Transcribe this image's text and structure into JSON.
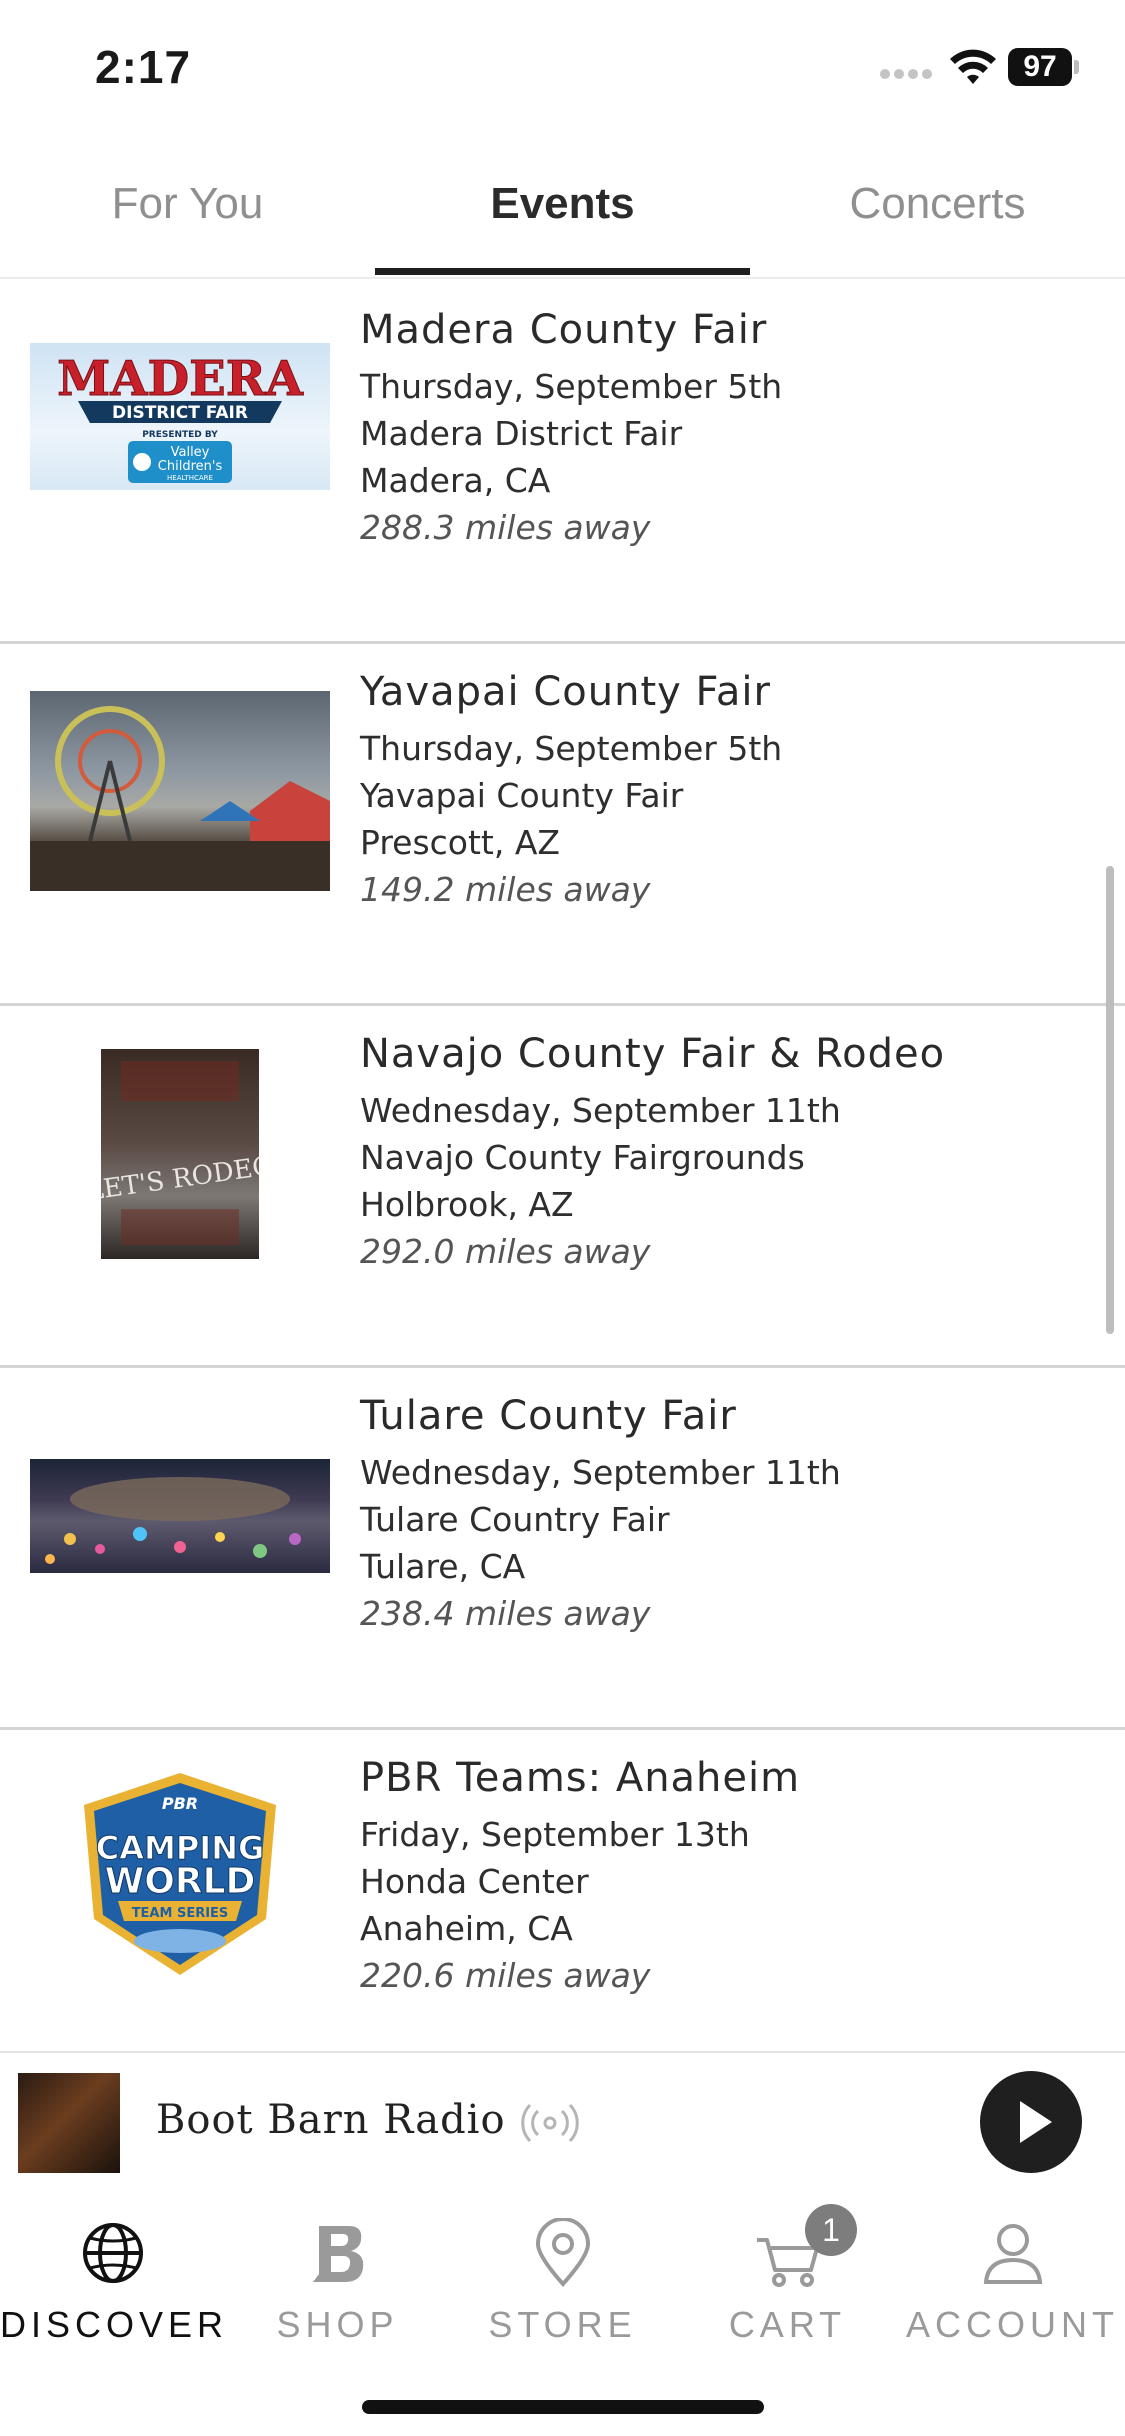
{
  "status": {
    "time": "2:17",
    "battery": "97"
  },
  "tabs": [
    {
      "label": "For You"
    },
    {
      "label": "Events"
    },
    {
      "label": "Concerts"
    }
  ],
  "events": [
    {
      "title": "Madera County Fair",
      "date": "Thursday, September 5th",
      "venue": "Madera District Fair",
      "city": "Madera, CA",
      "distance": "288.3 miles away",
      "logo": {
        "line1": "MADERA",
        "line2": "DISTRICT FAIR",
        "line3": "PRESENTED BY",
        "line4": "Valley",
        "line5": "Children's",
        "line6": "HEALTHCARE"
      }
    },
    {
      "title": "Yavapai County Fair",
      "date": "Thursday, September 5th",
      "venue": "Yavapai County Fair",
      "city": "Prescott, AZ",
      "distance": "149.2 miles away"
    },
    {
      "title": "Navajo County Fair & Rodeo",
      "date": "Wednesday, September 11th",
      "venue": "Navajo County Fairgrounds",
      "city": "Holbrook, AZ",
      "distance": "292.0 miles away",
      "poster_text": "LET'S RODEO"
    },
    {
      "title": "Tulare County Fair",
      "date": "Wednesday, September 11th",
      "venue": "Tulare Country Fair",
      "city": "Tulare, CA",
      "distance": "238.4 miles away"
    },
    {
      "title": "PBR Teams: Anaheim",
      "date": "Friday, September 13th",
      "venue": "Honda Center",
      "city": "Anaheim, CA",
      "distance": "220.6 miles away",
      "logo": {
        "line1": "PBR",
        "line2": "CAMPING",
        "line3": "WORLD",
        "line4": "TEAM SERIES"
      }
    }
  ],
  "player": {
    "title": "Boot Barn Radio"
  },
  "nav": {
    "items": [
      {
        "label": "DISCOVER",
        "icon": "globe-icon"
      },
      {
        "label": "SHOP",
        "icon": "boot-barn-b-icon"
      },
      {
        "label": "STORE",
        "icon": "map-pin-icon"
      },
      {
        "label": "CART",
        "icon": "cart-icon"
      },
      {
        "label": "ACCOUNT",
        "icon": "person-icon"
      }
    ],
    "cart_count": "1"
  },
  "colors": {
    "active_tab": "#2b2b2b",
    "inactive_tab": "#8f8f8f",
    "badge": "#7d7d7d"
  }
}
